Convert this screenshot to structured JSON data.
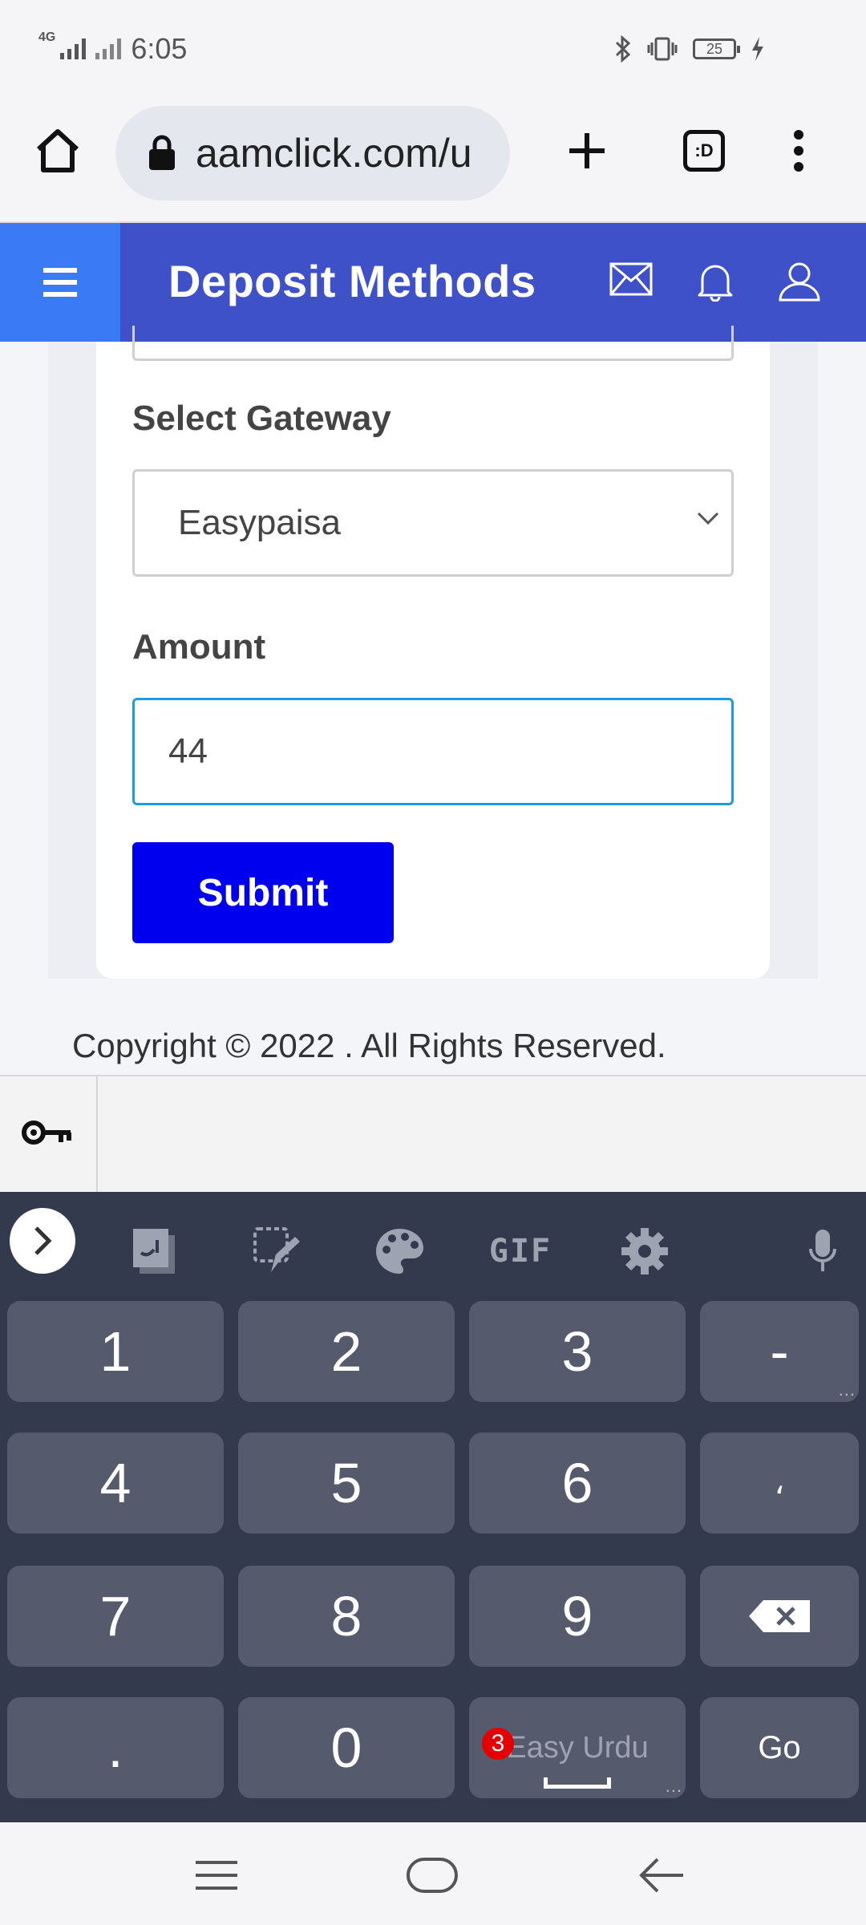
{
  "status_bar": {
    "network": "4G",
    "time": "6:05",
    "battery": "25"
  },
  "browser": {
    "url": "aamclick.com/u",
    "tab_count_label": ":D"
  },
  "header": {
    "title": "Deposit Methods"
  },
  "form": {
    "gateway_label": "Select Gateway",
    "gateway_value": "Easypaisa",
    "amount_label": "Amount",
    "amount_value": "44",
    "submit_label": "Submit"
  },
  "footer": {
    "copyright": "Copyright © 2022 . All Rights Reserved."
  },
  "keyboard": {
    "toolbar": {
      "gif_label": "GIF"
    },
    "keys": [
      [
        "1",
        "2",
        "3",
        "-"
      ],
      [
        "4",
        "5",
        "6",
        "،"
      ],
      [
        "7",
        "8",
        "9",
        "⌫"
      ],
      [
        ".",
        "0",
        "Easy Urdu",
        "Go"
      ]
    ],
    "space_badge": "3",
    "space_label": "Easy Urdu",
    "go_label": "Go"
  },
  "colors": {
    "header_bg": "#3f51c8",
    "menu_bg": "#3a7af5",
    "submit_bg": "#0000ee",
    "input_focus": "#1e9be0",
    "keyboard_bg": "#343a4e"
  }
}
